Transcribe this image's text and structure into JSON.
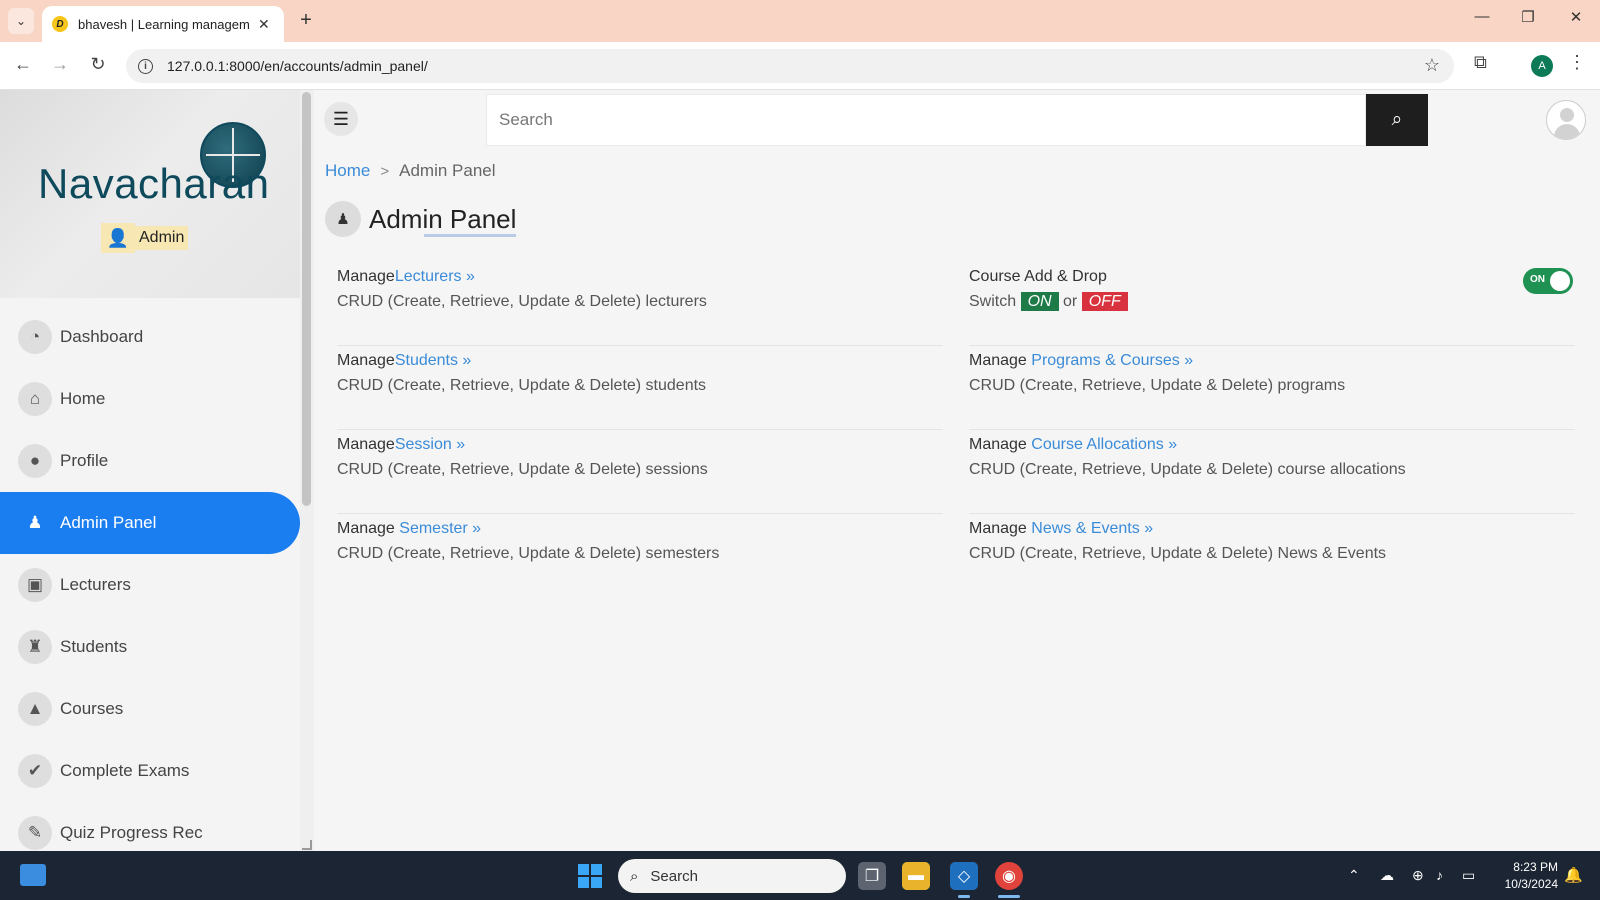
{
  "browser": {
    "tab_title": "bhavesh | Learning management",
    "favicon_letter": "D",
    "url": "127.0.0.1:8000/en/accounts/admin_panel/",
    "profile_initial": "A"
  },
  "sidebar": {
    "brand": "Navacharan",
    "role_label": "Admin",
    "items": [
      {
        "label": "Dashboard",
        "icon": "dashboard-icon",
        "glyph": "◔"
      },
      {
        "label": "Home",
        "icon": "home-icon",
        "glyph": "⌂"
      },
      {
        "label": "Profile",
        "icon": "profile-icon",
        "glyph": "●"
      },
      {
        "label": "Admin Panel",
        "icon": "admin-user-icon",
        "glyph": "♟",
        "active": true
      },
      {
        "label": "Lecturers",
        "icon": "lecturer-icon",
        "glyph": "▣"
      },
      {
        "label": "Students",
        "icon": "student-icon",
        "glyph": "♜"
      },
      {
        "label": "Courses",
        "icon": "graduation-cap-icon",
        "glyph": "▲"
      },
      {
        "label": "Complete Exams",
        "icon": "check-circle-icon",
        "glyph": "✔"
      },
      {
        "label": "Quiz Progress Rec",
        "icon": "edit-icon",
        "glyph": "✎"
      }
    ]
  },
  "header": {
    "search_placeholder": "Search"
  },
  "breadcrumb": {
    "home": "Home",
    "separator": ">",
    "current": "Admin Panel"
  },
  "page": {
    "title": "Admin Panel"
  },
  "panel": {
    "left": [
      {
        "prefix": "Manage",
        "link": "Lecturers »",
        "desc": "CRUD (Create, Retrieve, Update & Delete) lecturers"
      },
      {
        "prefix": "Manage",
        "link": "Students »",
        "desc": "CRUD (Create, Retrieve, Update & Delete) students"
      },
      {
        "prefix": "Manage",
        "link": "Session »",
        "desc": "CRUD (Create, Retrieve, Update & Delete) sessions"
      },
      {
        "prefix": "Manage ",
        "link": "Semester »",
        "desc": "CRUD (Create, Retrieve, Update & Delete) semesters"
      }
    ],
    "course_add_drop": {
      "title": "Course Add & Drop",
      "switch_word": "Switch",
      "on_label": "ON",
      "or_word": "or",
      "off_label": "OFF",
      "toggle_label": "ON",
      "toggle_state": true
    },
    "right": [
      {
        "prefix": "Manage ",
        "link": "Programs & Courses »",
        "desc": "CRUD (Create, Retrieve, Update & Delete) programs"
      },
      {
        "prefix": "Manage ",
        "link": "Course Allocations »",
        "desc": "CRUD (Create, Retrieve, Update & Delete) course allocations"
      },
      {
        "prefix": "Manage ",
        "link": "News & Events »",
        "desc": "CRUD (Create, Retrieve, Update & Delete) News & Events"
      }
    ]
  },
  "taskbar": {
    "search_label": "Search",
    "time": "8:23 PM",
    "date": "10/3/2024"
  },
  "colors": {
    "accent": "#1a7df0",
    "link": "#3a8bd8",
    "on_badge": "#1e7a46",
    "off_badge": "#d9323f",
    "toggle": "#1f9152"
  }
}
